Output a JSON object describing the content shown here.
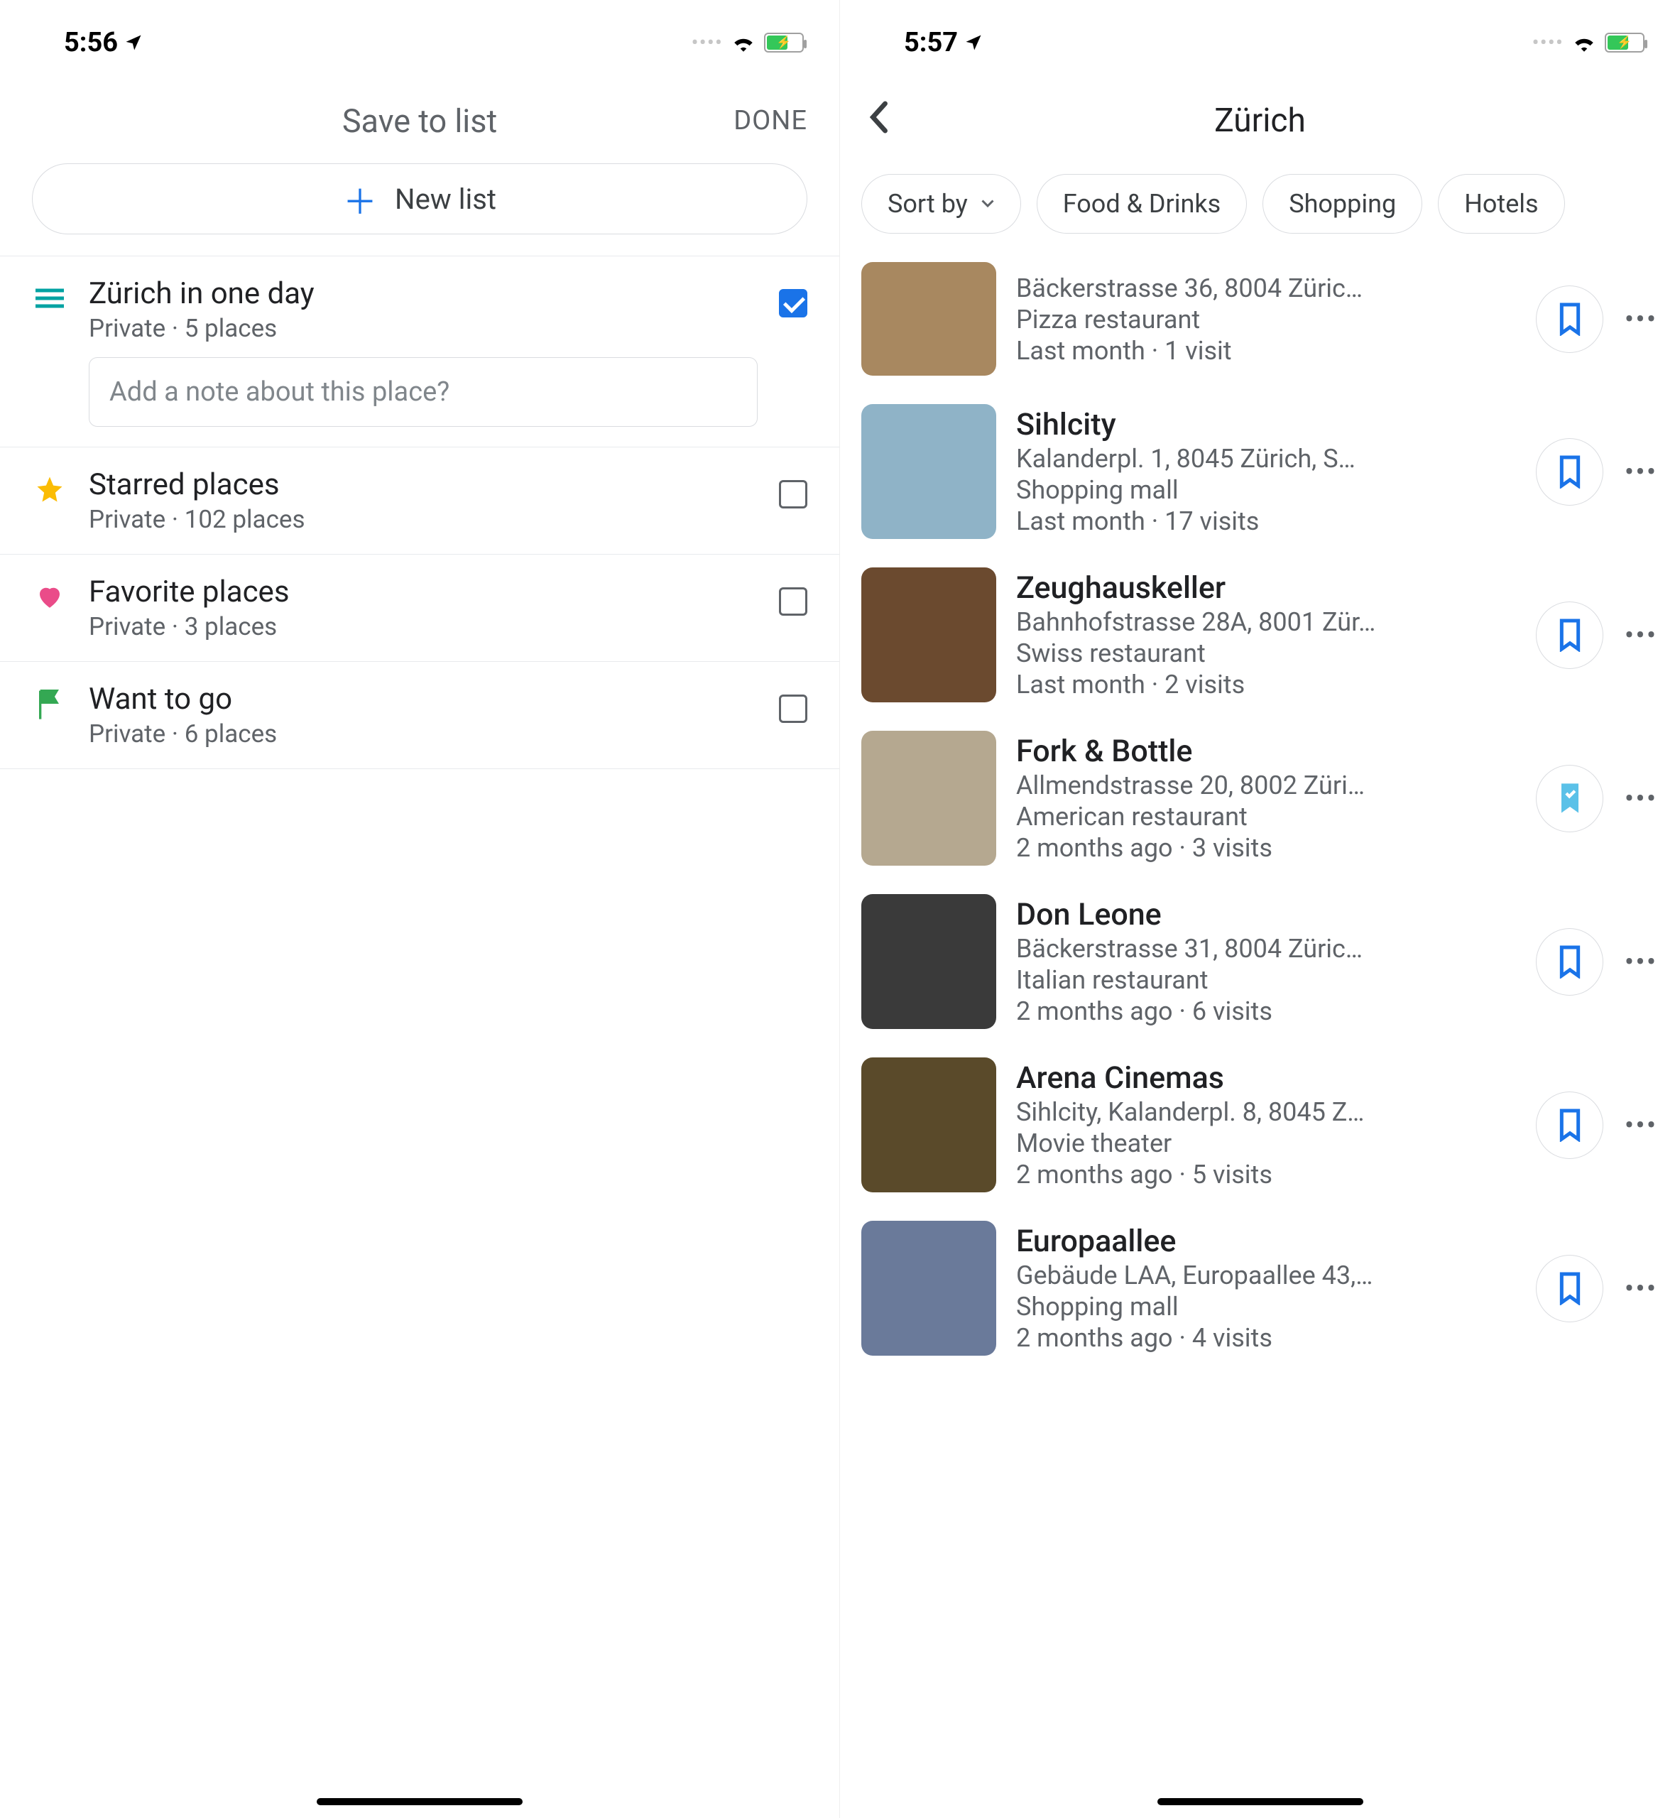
{
  "left": {
    "status_time": "5:56",
    "header_title": "Save to list",
    "done_label": "DONE",
    "new_list_label": "New list",
    "note_placeholder": "Add a note about this place?",
    "lists": [
      {
        "title": "Zürich in one day",
        "sub": "Private · 5 places",
        "checked": true,
        "icon": "list-teal"
      },
      {
        "title": "Starred places",
        "sub": "Private · 102 places",
        "checked": false,
        "icon": "star"
      },
      {
        "title": "Favorite places",
        "sub": "Private · 3 places",
        "checked": false,
        "icon": "heart"
      },
      {
        "title": "Want to go",
        "sub": "Private · 6 places",
        "checked": false,
        "icon": "flag"
      }
    ]
  },
  "right": {
    "status_time": "5:57",
    "title": "Zürich",
    "filters": {
      "sort_label": "Sort by",
      "chips": [
        "Food & Drinks",
        "Shopping",
        "Hotels"
      ]
    },
    "places": [
      {
        "title": "",
        "address": "Bäckerstrasse 36, 8004 Züric…",
        "category": "Pizza restaurant",
        "visit": "Last month · 1 visit",
        "saved_variant": "outline",
        "partial": true,
        "thumb": "#a88860"
      },
      {
        "title": "Sihlcity",
        "address": "Kalanderpl. 1, 8045 Zürich, S…",
        "category": "Shopping mall",
        "visit": "Last month · 17 visits",
        "saved_variant": "outline",
        "thumb": "#8fb3c7"
      },
      {
        "title": "Zeughauskeller",
        "address": "Bahnhofstrasse 28A, 8001 Zür…",
        "category": "Swiss restaurant",
        "visit": "Last month · 2 visits",
        "saved_variant": "outline",
        "thumb": "#6b4a2f"
      },
      {
        "title": "Fork & Bottle",
        "address": "Allmendstrasse 20, 8002 Züri…",
        "category": "American restaurant",
        "visit": "2 months ago · 3 visits",
        "saved_variant": "filled",
        "thumb": "#b5a890"
      },
      {
        "title": "Don Leone",
        "address": "Bäckerstrasse 31, 8004 Züric…",
        "category": "Italian restaurant",
        "visit": "2 months ago · 6 visits",
        "saved_variant": "outline",
        "thumb": "#3a3a3a"
      },
      {
        "title": "Arena Cinemas",
        "address": "Sihlcity, Kalanderpl. 8, 8045 Z…",
        "category": "Movie theater",
        "visit": "2 months ago · 5 visits",
        "saved_variant": "outline",
        "thumb": "#5a4a2a"
      },
      {
        "title": "Europaallee",
        "address": "Gebäude LAA, Europaallee 43,…",
        "category": "Shopping mall",
        "visit": "2 months ago · 4 visits",
        "saved_variant": "outline",
        "thumb": "#6a7a9a",
        "partial_bottom": true
      }
    ]
  }
}
